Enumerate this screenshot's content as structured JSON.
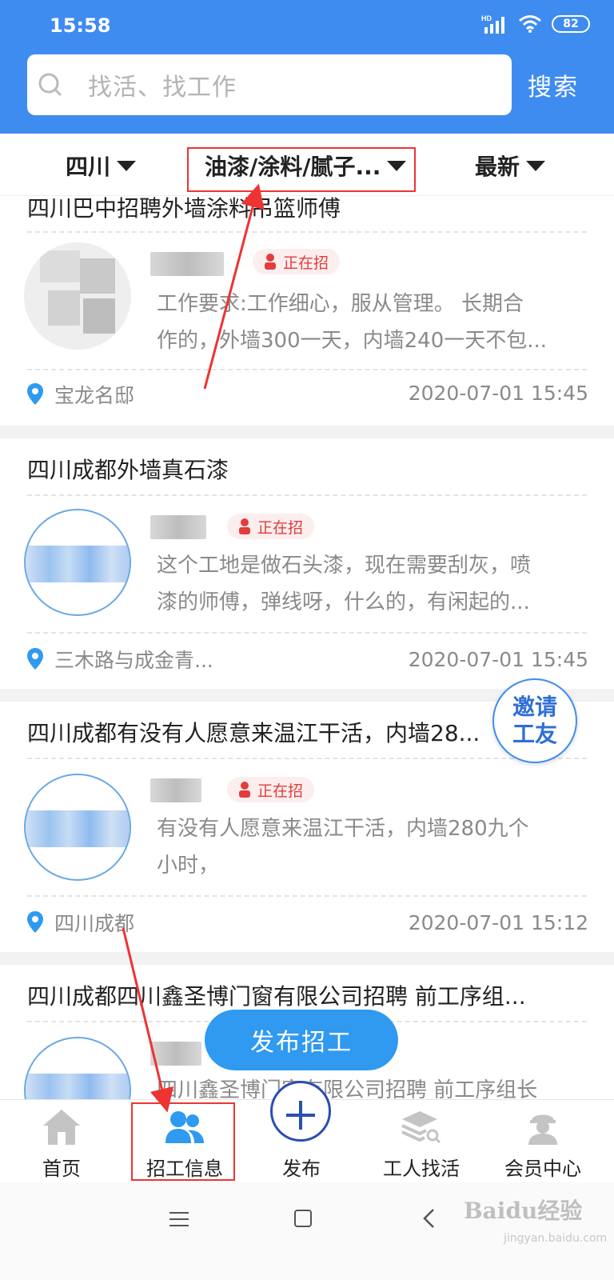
{
  "status_bar": {
    "time": "15:58",
    "network": "HD",
    "battery": "82"
  },
  "search": {
    "placeholder": "找活、找工作",
    "button": "搜索"
  },
  "filters": {
    "region": "四川",
    "category": "油漆/涂料/腻子...",
    "sort": "最新"
  },
  "listings": [
    {
      "title": "四川巴中招聘外墙涂料吊篮师傅",
      "status": "正在招",
      "desc": [
        "工作要求:工作细心，服从管理。 长期合",
        "作的，外墙300一天，内墙240一天不包..."
      ],
      "location": "宝龙名邸",
      "time": "2020-07-01 15:45"
    },
    {
      "title": "四川成都外墙真石漆",
      "status": "正在招",
      "desc": [
        "这个工地是做石头漆，现在需要刮灰，喷",
        "漆的师傅，弹线呀，什么的，有闲起的..."
      ],
      "location": "三木路与成金青...",
      "time": "2020-07-01 15:45"
    },
    {
      "title": "四川成都有没有人愿意来温江干活，内墙28...",
      "status": "正在招",
      "desc": [
        "有没有人愿意来温江干活，内墙280九个",
        "小时，"
      ],
      "location": "四川成都",
      "time": "2020-07-01 15:12"
    },
    {
      "title": "四川成都四川鑫圣博门窗有限公司招聘 前工序组...",
      "desc": [
        "四川鑫圣博门窗有限公司招聘 前工序组长"
      ]
    }
  ],
  "invite": {
    "line1": "邀请",
    "line2": "工友"
  },
  "publish_button": "发布招工",
  "tabs": {
    "home": "首页",
    "recruit": "招工信息",
    "publish": "发布",
    "find_work": "工人找活",
    "member": "会员中心"
  },
  "watermark": {
    "brand": "Baidu经验",
    "url": "jingyan.baidu.com"
  },
  "colors": {
    "primary": "#3f8cf0",
    "badge_red": "#e23c3c",
    "annotation": "#ee3333"
  }
}
